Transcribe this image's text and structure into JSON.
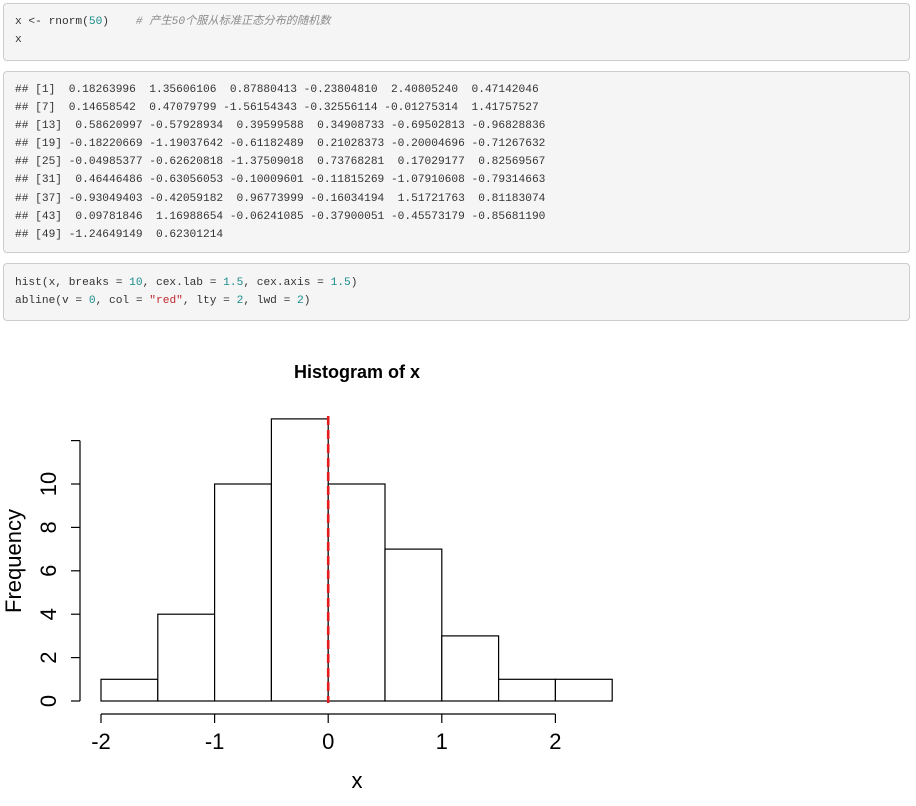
{
  "code_block_1": {
    "line1_code": "x <- rnorm(",
    "line1_num": "50",
    "line1_close": ")",
    "line1_comment": "# 产生50个服从标准正态分布的随机数",
    "line2": "x"
  },
  "output_block": {
    "lines": [
      "## [1]  0.18263996  1.35606106  0.87880413 -0.23804810  2.40805240  0.47142046",
      "## [7]  0.14658542  0.47079799 -1.56154343 -0.32556114 -0.01275314  1.41757527",
      "## [13]  0.58620997 -0.57928934  0.39599588  0.34908733 -0.69502813 -0.96828836",
      "## [19] -0.18220669 -1.19037642 -0.61182489  0.21028373 -0.20004696 -0.71267632",
      "## [25] -0.04985377 -0.62620818 -1.37509018  0.73768281  0.17029177  0.82569567",
      "## [31]  0.46446486 -0.63056053 -0.10009601 -0.11815269 -1.07910608 -0.79314663",
      "## [37] -0.93049403 -0.42059182  0.96773999 -0.16034194  1.51721763  0.81183074",
      "## [43]  0.09781846  1.16988654 -0.06241085 -0.37900051 -0.45573179 -0.85681190",
      "## [49] -1.24649149  0.62301214"
    ]
  },
  "code_block_2": {
    "line1_a": "hist(x, breaks = ",
    "line1_n1": "10",
    "line1_b": ", cex.lab = ",
    "line1_n2": "1.5",
    "line1_c": ", cex.axis = ",
    "line1_n3": "1.5",
    "line1_d": ")",
    "line2_a": "abline(v = ",
    "line2_n1": "0",
    "line2_b": ", col = ",
    "line2_s1": "\"red\"",
    "line2_c": ", lty = ",
    "line2_n2": "2",
    "line2_d": ", lwd = ",
    "line2_n3": "2",
    "line2_e": ")"
  },
  "chart_data": {
    "type": "bar",
    "title": "Histogram of x",
    "xlabel": "x",
    "ylabel": "Frequency",
    "bin_edges": [
      -2,
      -1.5,
      -1,
      -0.5,
      0,
      0.5,
      1,
      1.5,
      2,
      2.5
    ],
    "values": [
      1,
      4,
      10,
      13,
      10,
      7,
      3,
      1,
      1
    ],
    "xlim": [
      -2,
      2.5
    ],
    "ylim": [
      0,
      13
    ],
    "x_ticks": [
      -2,
      -1,
      0,
      1,
      2
    ],
    "x_tick_labels": [
      "-2",
      "-1",
      "0",
      "1",
      "2"
    ],
    "y_ticks": [
      0,
      2,
      4,
      6,
      8,
      10,
      12
    ],
    "y_tick_labels": [
      "0",
      "2",
      "4",
      "6",
      "8",
      "10",
      ""
    ],
    "vline": {
      "x": 0,
      "color": "#e41a1c",
      "style": "dashed"
    },
    "grid": false,
    "bar_fill": "#ffffff",
    "bar_stroke": "#000000"
  }
}
